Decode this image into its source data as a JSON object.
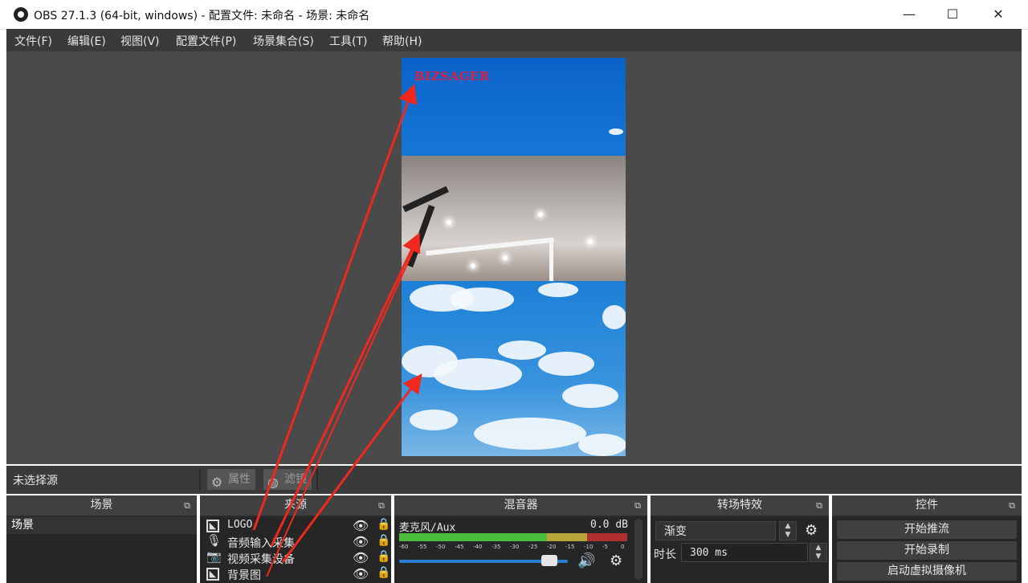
{
  "window": {
    "title": "OBS 27.1.3 (64-bit, windows) - 配置文件: 未命名 - 场景: 未命名",
    "minimize_icon": "—",
    "maximize_icon": "☐",
    "close_icon": "✕"
  },
  "menu": [
    "文件(F)",
    "编辑(E)",
    "视图(V)",
    "配置文件(P)",
    "场景集合(S)",
    "工具(T)",
    "帮助(H)"
  ],
  "preview": {
    "logo_text": "BIZSAGER"
  },
  "source_toolbar": {
    "no_source": "未选择源",
    "properties_label": "属性",
    "filters_label": "滤镜"
  },
  "docks": {
    "scenes": {
      "title": "场景",
      "items": [
        "场景"
      ]
    },
    "sources": {
      "title": "来源",
      "items": [
        {
          "label": "LOGO",
          "icon": "image-icon"
        },
        {
          "label": "音频输入采集",
          "icon": "microphone-icon"
        },
        {
          "label": "视频采集设备",
          "icon": "camera-icon"
        },
        {
          "label": "背景图",
          "icon": "image-icon"
        }
      ]
    },
    "mixer": {
      "title": "混音器",
      "channel_name": "麦克风/Aux",
      "db_value": "0.0 dB",
      "ticks": [
        "-60",
        "-55",
        "-50",
        "-45",
        "-40",
        "-35",
        "-30",
        "-25",
        "-20",
        "-15",
        "-10",
        "-5",
        "0"
      ],
      "volume_level": 0.93
    },
    "transitions": {
      "title": "转场特效",
      "selected": "渐变",
      "duration_label": "时长",
      "duration_value": "300 ms"
    },
    "controls": {
      "title": "控件",
      "buttons": [
        "开始推流",
        "开始录制",
        "启动虚拟摄像机"
      ]
    }
  },
  "colors": {
    "annotation_arrow": "#f0281e",
    "logo_red": "#e0203a",
    "meter_green": "#4bbf3c",
    "meter_yellow": "#b8a53a",
    "meter_red": "#b03030",
    "slider_blue": "#2b7fd1"
  }
}
